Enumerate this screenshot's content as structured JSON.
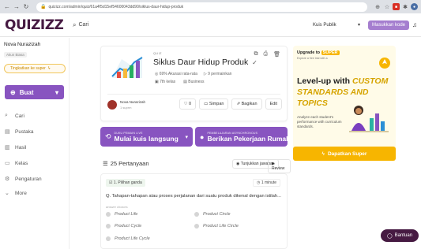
{
  "browser": {
    "url": "quizizz.com/admin/quiz/61a4f5d15ef54600043dd90/siklus-daur-hidup-produk"
  },
  "header": {
    "logo": "QUIZIZZ",
    "search_placeholder": "Cari",
    "filter_label": "Kuis Publik",
    "login_label": "Masukkan kode"
  },
  "sidebar": {
    "user_name": "Nova Nurazizah",
    "user_role": "Akun Biasa",
    "upgrade_label": "Tingkatkan ke super",
    "create_label": "Buat",
    "items": [
      {
        "label": "Cari"
      },
      {
        "label": "Pustaka"
      },
      {
        "label": "Hasil"
      },
      {
        "label": "Kelas"
      },
      {
        "label": "Pengaturan"
      },
      {
        "label": "More"
      }
    ]
  },
  "quiz": {
    "tag": "QUIZ",
    "title": "Siklus Daur Hidup Produk",
    "accuracy": "69% Akurasi rata-rata",
    "plays": "9 permainkan",
    "grade": "7th kelas",
    "subject": "Business",
    "author_name": "Nova Nurazizah",
    "author_sub": "1 suprm",
    "likes": "0",
    "save_label": "Simpan",
    "share_label": "Bagikan",
    "edit_label": "Edit"
  },
  "play": {
    "live_top": "DUKU PEMAIN LIVE",
    "live_label": "Mulai kuis langsung",
    "hw_top": "PEMBELAJARAN ASYNCHRONOUS",
    "hw_label": "Berikan Pekerjaan Rumah"
  },
  "questions": {
    "count_label": "25 Pertanyaan",
    "answers_label": "Tunjukkan jawaban",
    "review_label": "Review",
    "first": {
      "type": "1. Pilihan ganda",
      "time": "1 minute",
      "text": "Q. Tahapan-tahapan atau proses perjalanan dari suatu produk dikenal dengan istilah...",
      "choices_label": "answer choices",
      "choices": [
        "Product Life",
        "Product Circle",
        "Product Cycle",
        "Product Life Circle",
        "Product Life Cycle"
      ]
    }
  },
  "promo": {
    "upgrade_to": "Upgrade to",
    "super": "SUPER",
    "sub": "Explore a free trial with a",
    "headline_1": "Level-up with ",
    "headline_accent": "CUSTOM STANDARDS AND TOPICS",
    "desc": "Analyze each student's performance with curriculum standards.",
    "cta": "Dapatkan Super"
  },
  "help": {
    "label": "Bantuan"
  },
  "colors": {
    "brand": "#461a42",
    "primary": "#8854c0",
    "super": "#f7b500"
  }
}
